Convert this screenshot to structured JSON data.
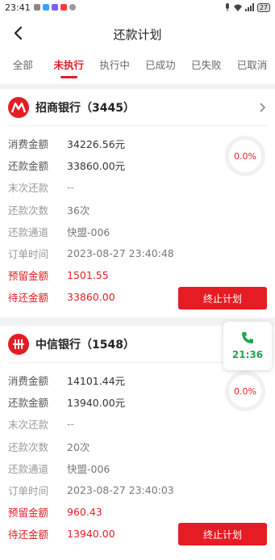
{
  "status_bar": {
    "time": "23:41",
    "battery": "27"
  },
  "nav": {
    "title": "还款计划"
  },
  "tabs": [
    {
      "label": "全部"
    },
    {
      "label": "未执行"
    },
    {
      "label": "执行中"
    },
    {
      "label": "已成功"
    },
    {
      "label": "已失败"
    },
    {
      "label": "已取消"
    }
  ],
  "active_tab": "未执行",
  "plans": [
    {
      "bank_name": "招商银行（3445）",
      "progress": "0.0%",
      "rows": [
        {
          "label": "消费金额",
          "value": "34226.56元"
        },
        {
          "label": "还款金额",
          "value": "33860.00元"
        },
        {
          "label": "末次还款",
          "value": "--"
        },
        {
          "label": "还款次数",
          "value": "36次"
        },
        {
          "label": "还款通道",
          "value": "快盟-006"
        },
        {
          "label": "订单时间",
          "value": "2023-08-27 23:40:48"
        },
        {
          "label": "预留金额",
          "value": "1501.55"
        },
        {
          "label": "待还金额",
          "value": "33860.00"
        }
      ],
      "stop_label": "终止计划"
    },
    {
      "bank_name": "中信银行（1548）",
      "progress": "0.0%",
      "rows": [
        {
          "label": "消费金额",
          "value": "14101.44元"
        },
        {
          "label": "还款金额",
          "value": "13940.00元"
        },
        {
          "label": "末次还款",
          "value": "--"
        },
        {
          "label": "还款次数",
          "value": "20次"
        },
        {
          "label": "还款通道",
          "value": "快盟-006"
        },
        {
          "label": "订单时间",
          "value": "2023-08-27 23:40:03"
        },
        {
          "label": "预留金额",
          "value": "960.43"
        },
        {
          "label": "待还金额",
          "value": "13940.00"
        }
      ],
      "stop_label": "终止计划"
    }
  ],
  "floating_call": {
    "time": "21:36"
  },
  "colors": {
    "accent": "#e51c23",
    "call_green": "#1aa84a"
  }
}
